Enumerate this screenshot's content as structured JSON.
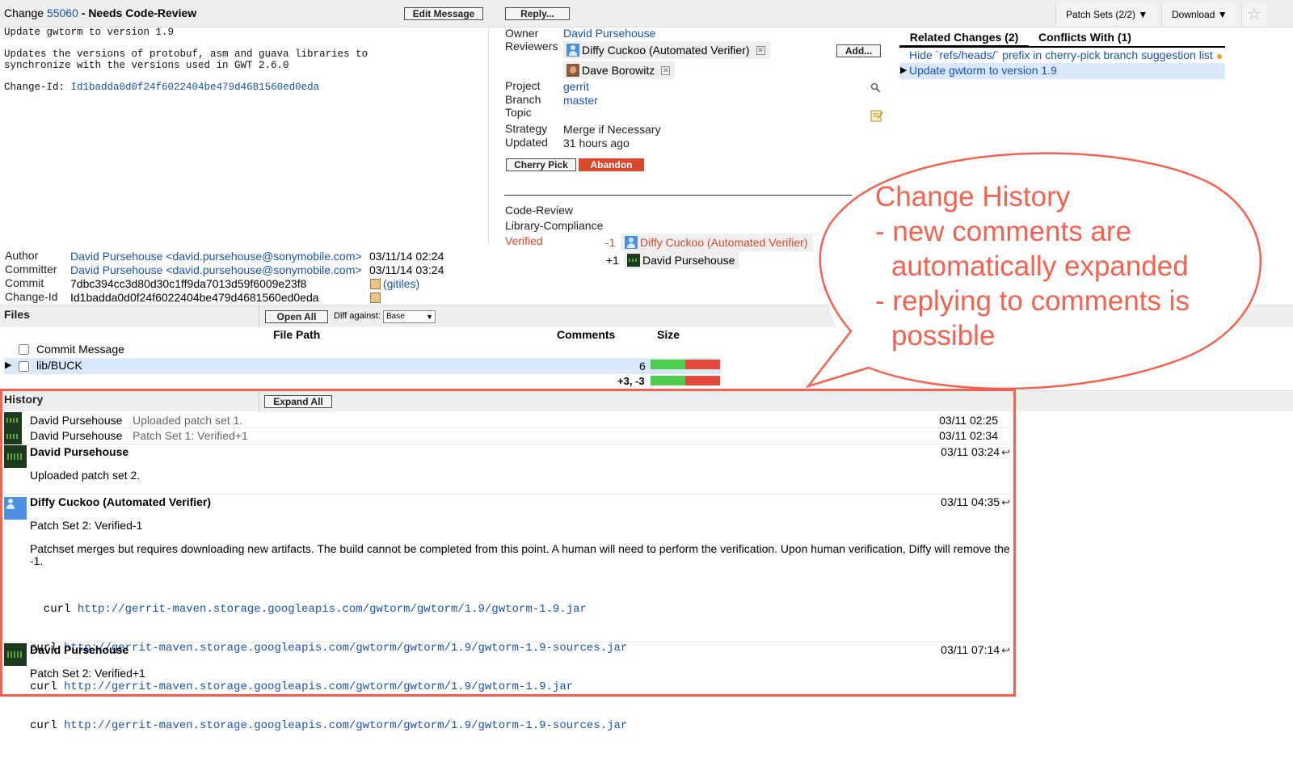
{
  "header": {
    "change_prefix": "Change",
    "change_number": "55060",
    "status": "- Needs Code-Review",
    "edit_message": "Edit Message",
    "reply": "Reply...",
    "patch_sets": "Patch Sets (2/2) ▼",
    "download": "Download ▼",
    "star": "☆"
  },
  "commit_message": {
    "subject": "Update gwtorm to version 1.9",
    "body_line1": "Updates the versions of protobuf, asm and guava libraries to",
    "body_line2": "synchronize with the versions used in GWT 2.6.0",
    "change_id_label": "Change-Id:",
    "change_id": "Id1badda0d0f24f6022404be479d4681560ed0eda"
  },
  "info": {
    "owner_label": "Owner",
    "owner": "David Pursehouse",
    "reviewers_label": "Reviewers",
    "reviewers": [
      "Diffy Cuckoo (Automated Verifier)",
      "Dave Borowitz"
    ],
    "add_button": "Add...",
    "project_label": "Project",
    "project": "gerrit",
    "branch_label": "Branch",
    "branch": "master",
    "topic_label": "Topic",
    "strategy_label": "Strategy",
    "strategy": "Merge if Necessary",
    "updated_label": "Updated",
    "updated": "31 hours ago",
    "cherry_pick": "Cherry Pick",
    "abandon": "Abandon"
  },
  "labels": {
    "code_review": "Code-Review",
    "library_compliance": "Library-Compliance",
    "verified": "Verified",
    "votes": [
      {
        "score": "-1",
        "name": "Diffy Cuckoo (Automated Verifier)"
      },
      {
        "score": "+1",
        "name": "David Pursehouse"
      }
    ]
  },
  "related": {
    "tab_related": "Related Changes (2)",
    "tab_conflicts": "Conflicts With (1)",
    "items": [
      "Hide `refs/heads/` prefix in cherry-pick branch suggestion list",
      "Update gwtorm to version 1.9"
    ]
  },
  "commit_info": {
    "author_label": "Author",
    "author": "David Pursehouse <david.pursehouse@sonymobile.com>",
    "author_date": "03/11/14 02:24",
    "committer_label": "Committer",
    "committer": "David Pursehouse <david.pursehouse@sonymobile.com>",
    "committer_date": "03/11/14 03:24",
    "commit_label": "Commit",
    "commit": "7dbc394cc3d80d30c1ff9da7013d59f6009e23f8",
    "gitiles": "(gitiles)",
    "change_id_label": "Change-Id",
    "change_id": "Id1badda0d0f24f6022404be479d4681560ed0eda"
  },
  "files": {
    "title": "Files",
    "open_all": "Open All",
    "diff_against_label": "Diff against:",
    "diff_against_value": "Base",
    "col_path": "File Path",
    "col_comments": "Comments",
    "col_size": "Size",
    "rows": [
      {
        "path": "Commit Message",
        "comments": "",
        "size_ratio": null
      },
      {
        "path": "lib/BUCK",
        "comments": "6",
        "size_ratio": 0.5
      }
    ],
    "total_delta": "+3, -3",
    "total_ratio": 0.5
  },
  "history": {
    "title": "History",
    "expand_all": "Expand All",
    "collapsed": [
      {
        "author": "David Pursehouse",
        "summary": "Uploaded patch set 1.",
        "date": "03/11 02:25"
      },
      {
        "author": "David Pursehouse",
        "summary": "Patch Set 1: Verified+1",
        "date": "03/11 02:34"
      }
    ],
    "expanded": [
      {
        "author": "David Pursehouse",
        "date": "03/11 03:24",
        "body": "Uploaded patch set 2."
      },
      {
        "author": "Diffy Cuckoo (Automated Verifier)",
        "date": "03/11 04:35",
        "body": "Patch Set 2: Verified-1",
        "para": "Patchset merges but requires downloading new artifacts. The build cannot be completed from this point. A human will need to perform the verification. Upon human verification, Diffy will remove the",
        "para_end": "-1.",
        "curls": [
          {
            "cmd": "  curl",
            "url": "http://gerrit-maven.storage.googleapis.com/gwtorm/gwtorm/1.9/gwtorm-1.9.jar"
          },
          {
            "cmd": "curl",
            "url": "http://gerrit-maven.storage.googleapis.com/gwtorm/gwtorm/1.9/gwtorm-1.9-sources.jar"
          },
          {
            "cmd": "curl",
            "url": "http://gerrit-maven.storage.googleapis.com/gwtorm/gwtorm/1.9/gwtorm-1.9.jar"
          },
          {
            "cmd": "curl",
            "url": "http://gerrit-maven.storage.googleapis.com/gwtorm/gwtorm/1.9/gwtorm-1.9-sources.jar"
          }
        ]
      },
      {
        "author": "David Pursehouse",
        "date": "03/11 07:14",
        "body": "Patch Set 2: Verified+1"
      }
    ],
    "reply_icon": "↩"
  },
  "callout": {
    "line1": "Change History",
    "line2": "- new comments are",
    "line3": "automatically expanded",
    "line4": "- replying to comments is",
    "line5": "possible"
  },
  "colors": {
    "callout": "#f4614f",
    "link": "#1a52b2",
    "abandon": "#d8482b",
    "verified_label": "#d8482b",
    "size_added": "#4ccd4c",
    "size_deleted": "#e3483b"
  },
  "icons": {
    "search": "search-icon",
    "edit": "edit-note-icon",
    "gitiles": "gitiles-icon",
    "copy": "copy-icon",
    "expand": "triangle-right-icon",
    "remove": "x-icon"
  }
}
